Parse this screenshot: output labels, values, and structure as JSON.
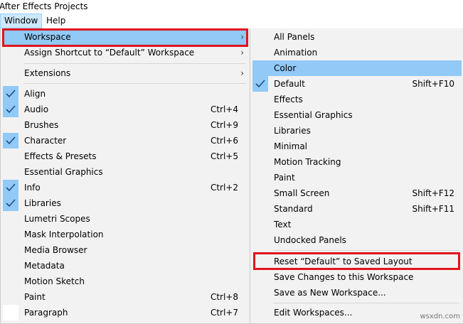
{
  "window_title": "After Effects Projects",
  "menubar": {
    "window": "Window",
    "help": "Help"
  },
  "main_menu": [
    {
      "label": "Workspace",
      "arrow": "›",
      "highlighted": true
    },
    {
      "label": "Assign Shortcut to “Default” Workspace",
      "arrow": "›"
    },
    {
      "label": "Extensions",
      "arrow": "›"
    },
    {
      "label": "Align",
      "checked": true
    },
    {
      "label": "Audio",
      "shortcut": "Ctrl+4",
      "checked": true
    },
    {
      "label": "Brushes",
      "shortcut": "Ctrl+9"
    },
    {
      "label": "Character",
      "shortcut": "Ctrl+6",
      "checked": true
    },
    {
      "label": "Effects & Presets",
      "shortcut": "Ctrl+5"
    },
    {
      "label": "Essential Graphics"
    },
    {
      "label": "Info",
      "shortcut": "Ctrl+2",
      "checked": true
    },
    {
      "label": "Libraries",
      "checked": true
    },
    {
      "label": "Lumetri Scopes"
    },
    {
      "label": "Mask Interpolation"
    },
    {
      "label": "Media Browser"
    },
    {
      "label": "Metadata"
    },
    {
      "label": "Motion Sketch"
    },
    {
      "label": "Paint",
      "shortcut": "Ctrl+8"
    },
    {
      "label": "Paragraph",
      "shortcut": "Ctrl+7"
    }
  ],
  "sub_menu": [
    {
      "label": "All Panels"
    },
    {
      "label": "Animation"
    },
    {
      "label": "Color",
      "highlighted": true
    },
    {
      "label": "Default",
      "shortcut": "Shift+F10",
      "checked": true
    },
    {
      "label": "Effects"
    },
    {
      "label": "Essential Graphics"
    },
    {
      "label": "Libraries"
    },
    {
      "label": "Minimal"
    },
    {
      "label": "Motion Tracking"
    },
    {
      "label": "Paint"
    },
    {
      "label": "Small Screen",
      "shortcut": "Shift+F12"
    },
    {
      "label": "Standard",
      "shortcut": "Shift+F11"
    },
    {
      "label": "Text"
    },
    {
      "label": "Undocked Panels"
    },
    {
      "label": "Reset “Default” to Saved Layout"
    },
    {
      "label": "Save Changes to this Workspace"
    },
    {
      "label": "Save as New Workspace..."
    },
    {
      "label": "Edit Workspaces..."
    }
  ],
  "watermark": "wsxdn.com",
  "colors": {
    "highlight": "#91c9f7",
    "annotation_box": "#e0141e"
  }
}
